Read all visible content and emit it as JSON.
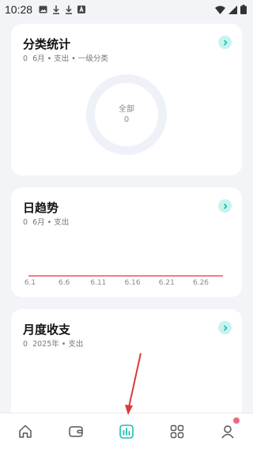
{
  "status_bar": {
    "time": "10:28"
  },
  "category_card": {
    "title": "分类统计",
    "sub_count": "0",
    "sub_text": "6月 • 支出 • 一级分类",
    "donut_label": "全部",
    "donut_value": "0"
  },
  "daily_card": {
    "title": "日趋势",
    "sub_count": "0",
    "sub_text": "6月 • 支出"
  },
  "monthly_card": {
    "title": "月度收支",
    "sub_count": "0",
    "sub_text": "2025年 • 支出"
  },
  "chart_data": {
    "type": "line",
    "title": "日趋势",
    "x": [
      "6.1",
      "6.6",
      "6.11",
      "6.16",
      "6.21",
      "6.26"
    ],
    "series": [
      {
        "values": [
          0,
          0,
          0,
          0,
          0,
          0
        ]
      }
    ],
    "color": "#f07a8a"
  },
  "tabbar": {
    "items": [
      "home-icon",
      "wallet-icon",
      "stats-icon",
      "apps-icon",
      "profile-icon"
    ],
    "active": "stats-icon",
    "accent": "#1bbfb0"
  },
  "annotation_color": "#d93a3a"
}
